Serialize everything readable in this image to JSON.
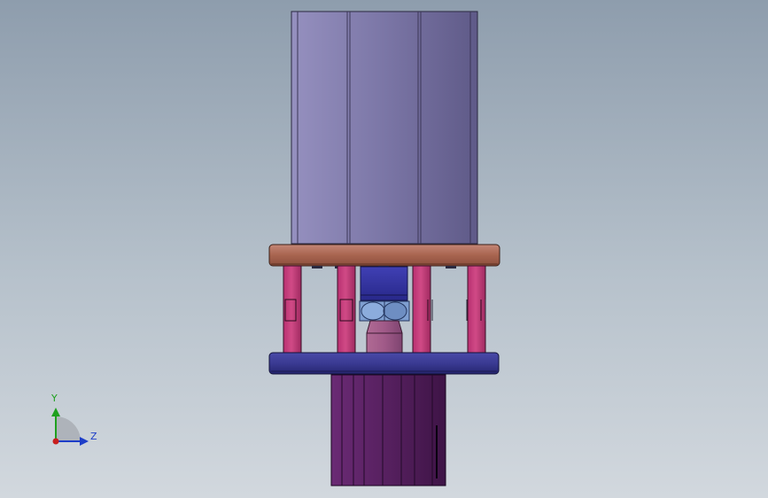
{
  "viewport": {
    "background_top": "#8e9dad",
    "background_bottom": "#d2d8de"
  },
  "model": {
    "cylinder_color": "#8580ae",
    "upper_plate_color": "#b07060",
    "lower_plate_color": "#3a3a92",
    "guide_post_color": "#c43c78",
    "center_block_color": "#3232a0",
    "nut_color": "#7f9fd0",
    "base_color": "#5a1e64"
  },
  "triad": {
    "y_label": "Y",
    "z_label": "Z",
    "y_color": "#1ea01e",
    "z_color": "#1e3ec8",
    "x_color": "#c81e1e"
  }
}
